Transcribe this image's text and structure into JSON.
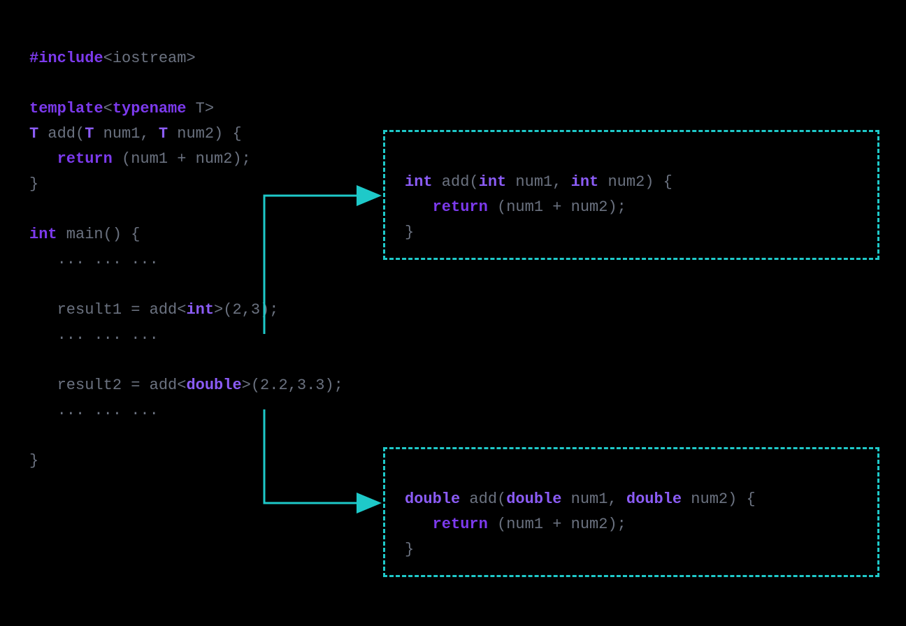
{
  "colors": {
    "keyword_purple": "#7c3aed",
    "keyword_violet": "#8b5cf6",
    "text_gray": "#6b7280",
    "accent_teal": "#1ec9c9",
    "background": "#000000"
  },
  "main_code": {
    "l1_include": "#include",
    "l1_header": "<iostream>",
    "l3_template": "template",
    "l3_lt": "<",
    "l3_typename": "typename",
    "l3_t_gt": " T>",
    "l4_t1": "T",
    "l4_add": " add(",
    "l4_t2": "T",
    "l4_num1": " num1, ",
    "l4_t3": "T",
    "l4_num2": " num2) {",
    "l5_indent": "   ",
    "l5_return": "return",
    "l5_expr": " (num1 + num2);",
    "l6_brace": "}",
    "l8_int": "int",
    "l8_main": " main() {",
    "l9_dots": "   ... ... ...",
    "l11_pre": "   result1 = add<",
    "l11_int": "int",
    "l11_post": ">(2,3);",
    "l12_dots": "   ... ... ...",
    "l14_pre": "   result2 = add<",
    "l14_double": "double",
    "l14_post": ">(2.2,3.3);",
    "l15_dots": "   ... ... ...",
    "l17_brace": "}"
  },
  "box_int": {
    "l1_int1": "int",
    "l1_add": " add(",
    "l1_int2": "int",
    "l1_num1": " num1, ",
    "l1_int3": "int",
    "l1_num2": " num2) {",
    "l2_indent": "   ",
    "l2_return": "return",
    "l2_expr": " (num1 + num2);",
    "l3_brace": "}"
  },
  "box_double": {
    "l1_d1": "double",
    "l1_add": " add(",
    "l1_d2": "double",
    "l1_num1": " num1, ",
    "l1_d3": "double",
    "l1_num2": " num2) {",
    "l2_indent": "   ",
    "l2_return": "return",
    "l2_expr": " (num1 + num2);",
    "l3_brace": "}"
  }
}
